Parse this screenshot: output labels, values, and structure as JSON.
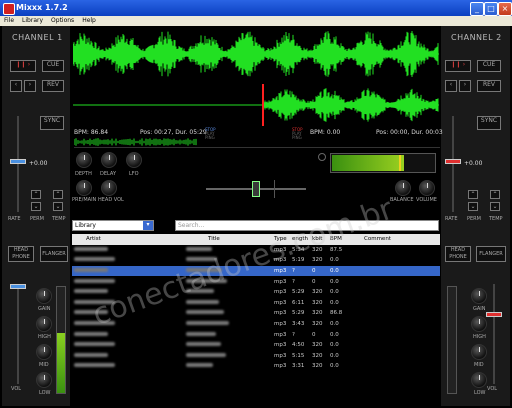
{
  "window": {
    "title": "Mixxx 1.7.2",
    "controls": [
      "_",
      "□",
      "×"
    ]
  },
  "menu": [
    "File",
    "Library",
    "Options",
    "Help"
  ],
  "channel1": {
    "title": "CHANNEL 1",
    "cue": "CUE",
    "rev": "REV",
    "sync": "SYNC",
    "rate_readout": "+0.00",
    "labels": {
      "rate": "RATE",
      "perm": "PERM",
      "temp": "TEMP"
    },
    "headphone": "HEAD PHONE",
    "flanger": "FLANGER",
    "eq": {
      "gain": "GAIN",
      "high": "HIGH",
      "mid": "MID",
      "low": "LOW"
    },
    "vol": "VOL",
    "bpm": "BPM: 86.84",
    "pos": "Pos: 00:27, Dur. 05:29",
    "stop_labels": [
      "STOP",
      "PLAY",
      "PING"
    ]
  },
  "channel2": {
    "title": "CHANNEL 2",
    "cue": "CUE",
    "rev": "REV",
    "sync": "SYNC",
    "rate_readout": "+0.00",
    "labels": {
      "rate": "RATE",
      "perm": "PERM",
      "temp": "TEMP"
    },
    "headphone": "HEAD PHONE",
    "flanger": "FLANGER",
    "eq": {
      "gain": "GAIN",
      "high": "HIGH",
      "mid": "MID",
      "low": "LOW"
    },
    "vol": "VOL",
    "bpm": "BPM: 0.00",
    "pos": "Pos: 00:00, Dur. 00:03",
    "stop_labels": [
      "STOP",
      "PLAY",
      "PING"
    ]
  },
  "mixer": {
    "knobs": {
      "depth": "DEPTH",
      "delay": "DELAY",
      "lfo": "LFO",
      "pre_main": "PRE/MAIN",
      "head_vol": "HEAD VOL",
      "balance": "BALANCE",
      "volume": "VOLUME"
    }
  },
  "library": {
    "selector": "Library",
    "search_placeholder": "Search...",
    "columns": [
      "Artist",
      "Title",
      "Type",
      "ength",
      "kbit",
      "BPM",
      "Comment"
    ],
    "rows": [
      {
        "type": "mp3",
        "length": "5:34",
        "kbit": "320",
        "bpm": "87.5",
        "selected": false
      },
      {
        "type": "mp3",
        "length": "5:19",
        "kbit": "320",
        "bpm": "0.0",
        "selected": false
      },
      {
        "type": "mp3",
        "length": "?",
        "kbit": "0",
        "bpm": "0.0",
        "selected": true
      },
      {
        "type": "mp3",
        "length": "?",
        "kbit": "0",
        "bpm": "0.0",
        "selected": false
      },
      {
        "type": "mp3",
        "length": "5:29",
        "kbit": "320",
        "bpm": "0.0",
        "selected": false
      },
      {
        "type": "mp3",
        "length": "6:11",
        "kbit": "320",
        "bpm": "0.0",
        "selected": false
      },
      {
        "type": "mp3",
        "length": "5:29",
        "kbit": "320",
        "bpm": "86.8",
        "selected": false
      },
      {
        "type": "mp3",
        "length": "3:43",
        "kbit": "320",
        "bpm": "0.0",
        "selected": false
      },
      {
        "type": "mp3",
        "length": "?",
        "kbit": "0",
        "bpm": "0.0",
        "selected": false
      },
      {
        "type": "mp3",
        "length": "4:50",
        "kbit": "320",
        "bpm": "0.0",
        "selected": false
      },
      {
        "type": "mp3",
        "length": "5:15",
        "kbit": "320",
        "bpm": "0.0",
        "selected": false
      },
      {
        "type": "mp3",
        "length": "3:31",
        "kbit": "320",
        "bpm": "0.0",
        "selected": false
      }
    ]
  },
  "watermark": "conectadores.com.br",
  "colors": {
    "wave": "#22e022",
    "playhead": "#ff2020",
    "selection": "#3566c8"
  }
}
